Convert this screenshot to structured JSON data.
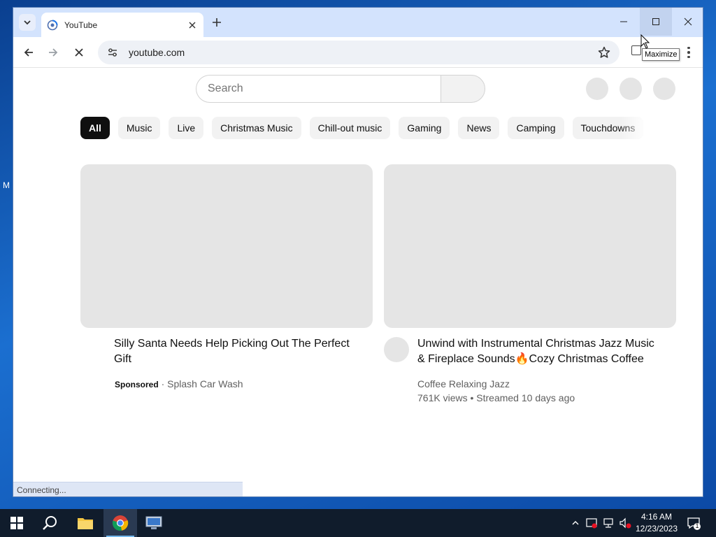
{
  "desktop": {
    "fragment_text": "M"
  },
  "browser": {
    "tab": {
      "title": "YouTube"
    },
    "address": {
      "url": "youtube.com"
    },
    "tooltip": "Maximize",
    "status": "Connecting..."
  },
  "youtube": {
    "search": {
      "placeholder": "Search"
    },
    "chips": [
      "All",
      "Music",
      "Live",
      "Christmas Music",
      "Chill-out music",
      "Gaming",
      "News",
      "Camping",
      "Touchdowns"
    ],
    "videos": [
      {
        "title": "Silly Santa Needs Help Picking Out The Perfect Gift",
        "sponsored_label": "Sponsored",
        "separator": "·",
        "advertiser": "Splash Car Wash"
      },
      {
        "title": "Unwind with Instrumental Christmas Jazz Music & Fireplace Sounds🔥Cozy Christmas Coffee Shop Ambience",
        "channel": "Coffee Relaxing Jazz",
        "stats": "761K views • Streamed 10 days ago"
      }
    ]
  },
  "taskbar": {
    "time": "4:16 AM",
    "date": "12/23/2023",
    "notification_count": "1"
  },
  "colors": {
    "accent": "#d3e3fd",
    "chip_active": "#0f0f0f",
    "taskbar": "#101c2c"
  }
}
